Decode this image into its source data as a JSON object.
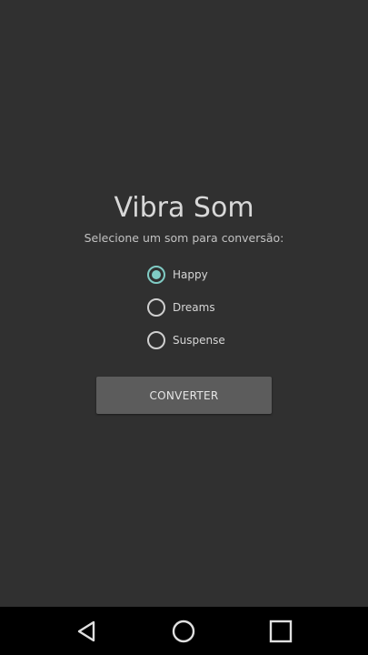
{
  "app": {
    "title": "Vibra Som",
    "subtitle": "Selecione um som para conversão:"
  },
  "radio_options": [
    {
      "label": "Happy",
      "checked": true
    },
    {
      "label": "Dreams",
      "checked": false
    },
    {
      "label": "Suspense",
      "checked": false
    }
  ],
  "convert_button": {
    "label": "CONVERTER"
  },
  "navigation_bar": {
    "buttons": [
      "back-icon",
      "home-icon",
      "recents-icon"
    ]
  },
  "colors": {
    "background": "#303030",
    "accent": "#80cbc4",
    "button": "#5c5c5c",
    "nav_bar": "#000000"
  }
}
